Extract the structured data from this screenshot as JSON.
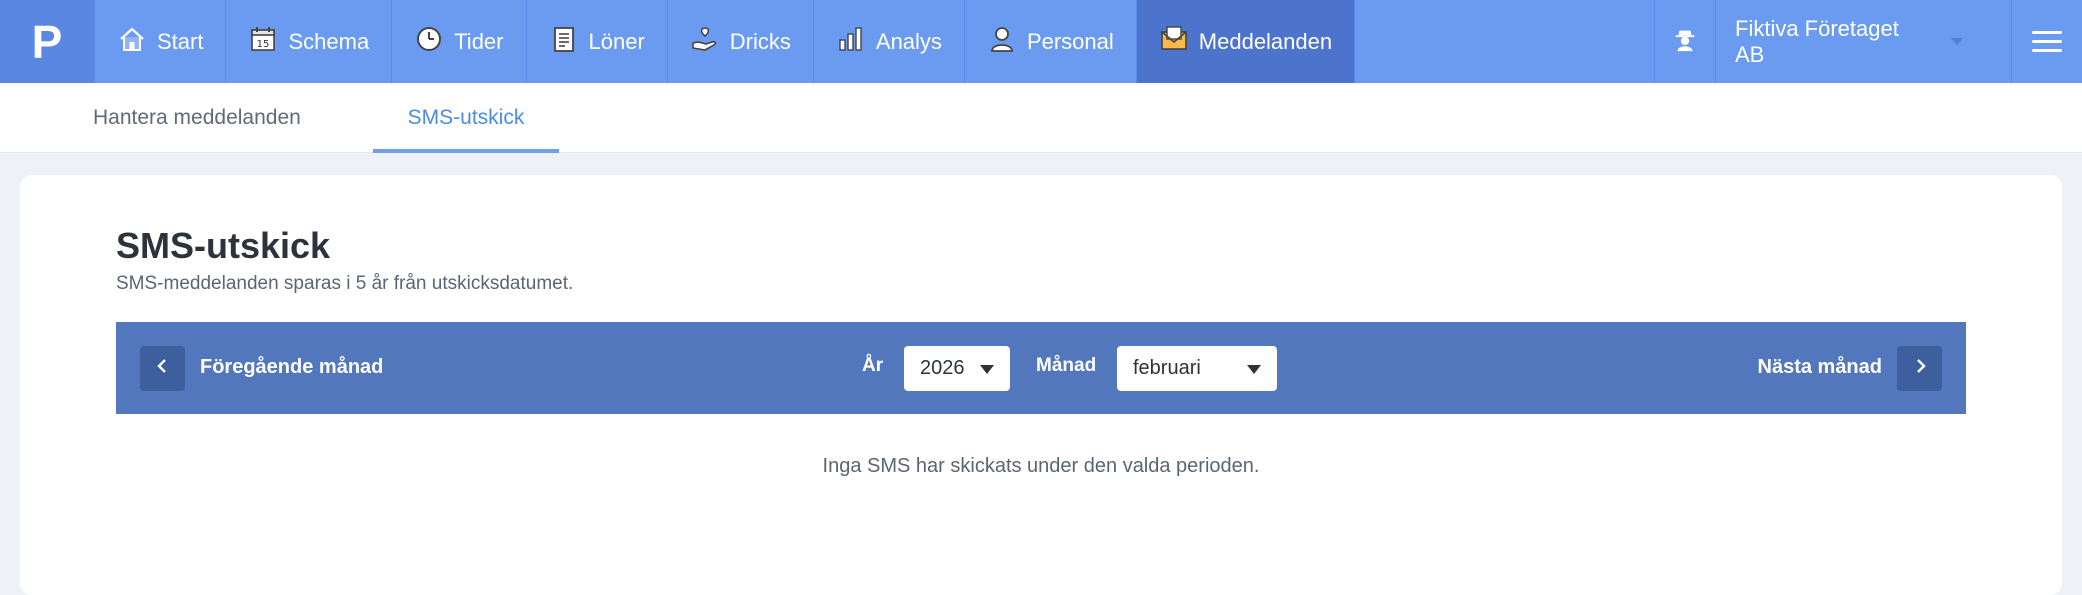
{
  "topnav": {
    "logo": "P",
    "items": [
      {
        "label": "Start",
        "icon": "home-icon"
      },
      {
        "label": "Schema",
        "icon": "calendar-icon",
        "badge": "15"
      },
      {
        "label": "Tider",
        "icon": "clock-icon"
      },
      {
        "label": "Löner",
        "icon": "document-icon"
      },
      {
        "label": "Dricks",
        "icon": "hand-coin-icon"
      },
      {
        "label": "Analys",
        "icon": "bar-chart-icon"
      },
      {
        "label": "Personal",
        "icon": "person-icon"
      },
      {
        "label": "Meddelanden",
        "icon": "envelope-icon",
        "active": true
      }
    ],
    "company": "Fiktiva Företaget AB"
  },
  "subnav": {
    "tabs": [
      {
        "label": "Hantera meddelanden",
        "active": false
      },
      {
        "label": "SMS-utskick",
        "active": true
      }
    ]
  },
  "page": {
    "title": "SMS-utskick",
    "subtitle": "SMS-meddelanden sparas i 5 år från utskicksdatumet."
  },
  "filter": {
    "prev_label": "Föregående månad",
    "next_label": "Nästa månad",
    "year_label": "År",
    "year_value": "2026",
    "month_label": "Månad",
    "month_value": "februari"
  },
  "empty_message": "Inga SMS har skickats under den valda perioden.",
  "colors": {
    "nav_bg": "#6b9bf0",
    "nav_active": "#4c74cc",
    "filter_bg": "#5277bd",
    "accent": "#4b8be6"
  }
}
